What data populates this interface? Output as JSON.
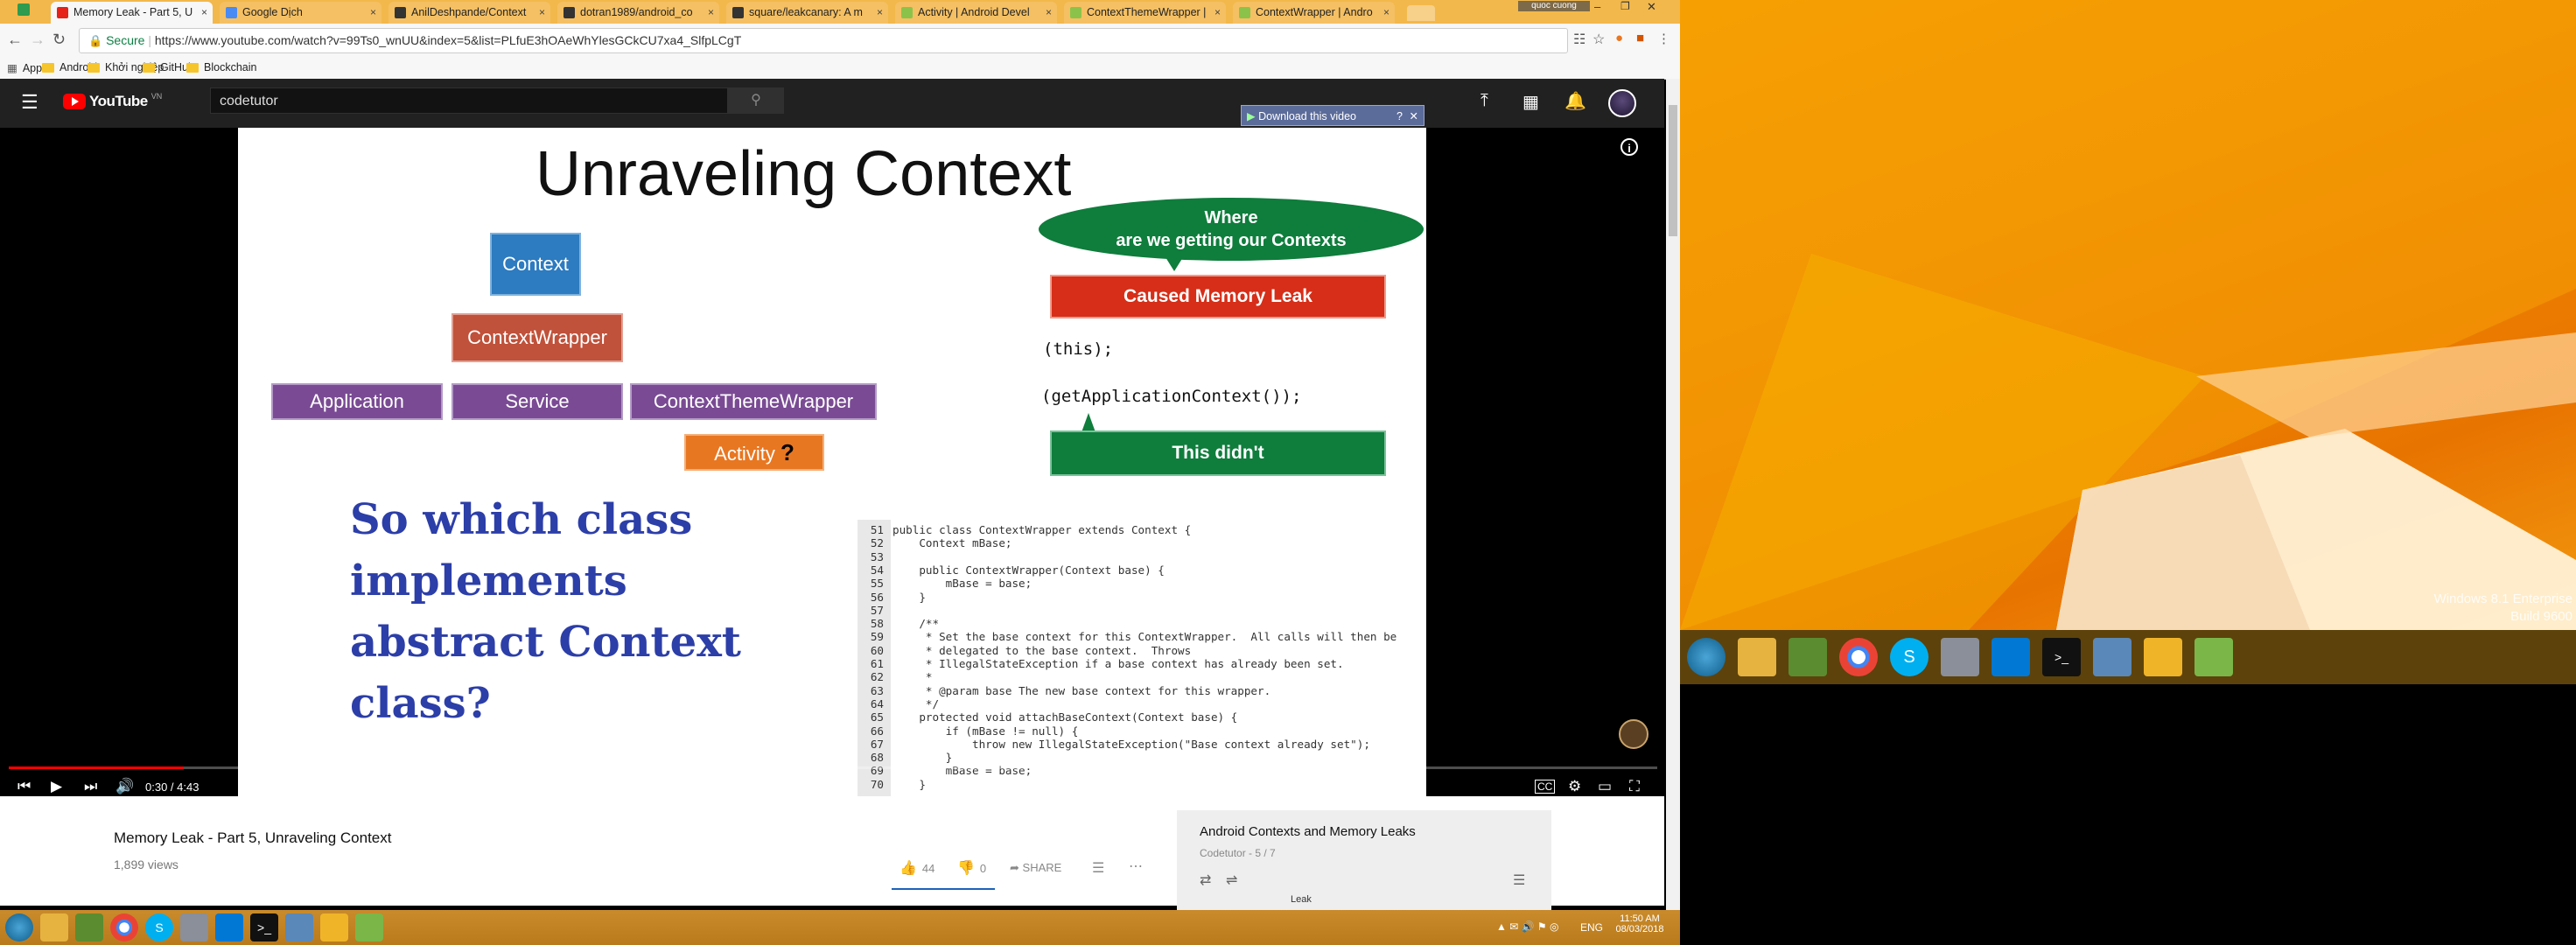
{
  "browser": {
    "tabs": [
      {
        "label": "Memory Leak - Part 5, U",
        "favicon_color": "#e62117"
      },
      {
        "label": "Google Dịch",
        "favicon_color": "#4a8af4"
      },
      {
        "label": "AnilDeshpande/Context",
        "favicon_color": "#333333"
      },
      {
        "label": "dotran1989/android_co",
        "favicon_color": "#333333"
      },
      {
        "label": "square/leakcanary: A m",
        "favicon_color": "#333333"
      },
      {
        "label": "Activity | Android Devel",
        "favicon_color": "#8bc34a"
      },
      {
        "label": "ContextThemeWrapper |",
        "favicon_color": "#8bc34a"
      },
      {
        "label": "ContextWrapper | Andro",
        "favicon_color": "#8bc34a"
      }
    ],
    "user_badge": "quoc cuong",
    "secure_label": "Secure",
    "url": "https://www.youtube.com/watch?v=99Ts0_wnUU&index=5&list=PLfuE3hOAeWhYlesGCkCU7xa4_SlfpLCgT",
    "bookmarks": [
      "Apps",
      "Android",
      "Khởi nghiệp",
      "GitHub",
      "Blockchain"
    ]
  },
  "youtube": {
    "logo_text": "YouTube",
    "region": "VN",
    "search_value": "codetutor",
    "download_label": "Download this video"
  },
  "slide": {
    "title": "Unraveling Context",
    "boxes": {
      "context": "Context",
      "context_wrapper": "ContextWrapper",
      "application": "Application",
      "service": "Service",
      "context_theme_wrapper": "ContextThemeWrapper",
      "activity": "Activity",
      "activity_q": "?"
    },
    "bubble": "Where\nare we getting our Contexts",
    "leak": "Caused Memory Leak",
    "this_code": "(this);",
    "app_ctx_code": "(getApplicationContext());",
    "didnt": "This didn't",
    "question": [
      "So which class",
      "implements",
      "abstract Context",
      "class?"
    ],
    "code_lines": [
      {
        "n": "51",
        "t": "public class ContextWrapper extends Context {"
      },
      {
        "n": "52",
        "t": "    Context mBase;"
      },
      {
        "n": "53",
        "t": ""
      },
      {
        "n": "54",
        "t": "    public ContextWrapper(Context base) {"
      },
      {
        "n": "55",
        "t": "        mBase = base;"
      },
      {
        "n": "56",
        "t": "    }"
      },
      {
        "n": "57",
        "t": ""
      },
      {
        "n": "58",
        "t": "    /**"
      },
      {
        "n": "59",
        "t": "     * Set the base context for this ContextWrapper.  All calls will then be"
      },
      {
        "n": "60",
        "t": "     * delegated to the base context.  Throws"
      },
      {
        "n": "61",
        "t": "     * IllegalStateException if a base context has already been set."
      },
      {
        "n": "62",
        "t": "     *"
      },
      {
        "n": "63",
        "t": "     * @param base The new base context for this wrapper."
      },
      {
        "n": "64",
        "t": "     */"
      },
      {
        "n": "65",
        "t": "    protected void attachBaseContext(Context base) {"
      },
      {
        "n": "66",
        "t": "        if (mBase != null) {"
      },
      {
        "n": "67",
        "t": "            throw new IllegalStateException(\"Base context already set\");"
      },
      {
        "n": "68",
        "t": "        }"
      },
      {
        "n": "69",
        "t": "        mBase = base;"
      },
      {
        "n": "70",
        "t": "    }"
      }
    ]
  },
  "player": {
    "time": "0:30 / 4:43",
    "progress": 0.106
  },
  "video": {
    "title": "Memory Leak - Part 5, Unraveling Context",
    "views": "1,899 views",
    "likes": "44",
    "dislikes": "0",
    "share": "SHARE"
  },
  "playlist": {
    "title": "Android Contexts and Memory Leaks",
    "subtitle": "Codetutor - 5 / 7",
    "next_item": "Leak"
  },
  "desktop": {
    "watermark_line1": "Windows 8.1 Enterprise",
    "watermark_line2": "Build 9600"
  },
  "taskbar": {
    "language": "ENG",
    "time": "11:50 AM",
    "date": "08/03/2018"
  },
  "colors": {
    "youtube_red": "#ff0000",
    "slide_blue": "#2d7bc0",
    "slide_brown": "#c0513a",
    "slide_purple": "#7a4b94",
    "slide_orange": "#e87722",
    "slide_green": "#0f7d3c",
    "slide_red": "#d62e18"
  }
}
